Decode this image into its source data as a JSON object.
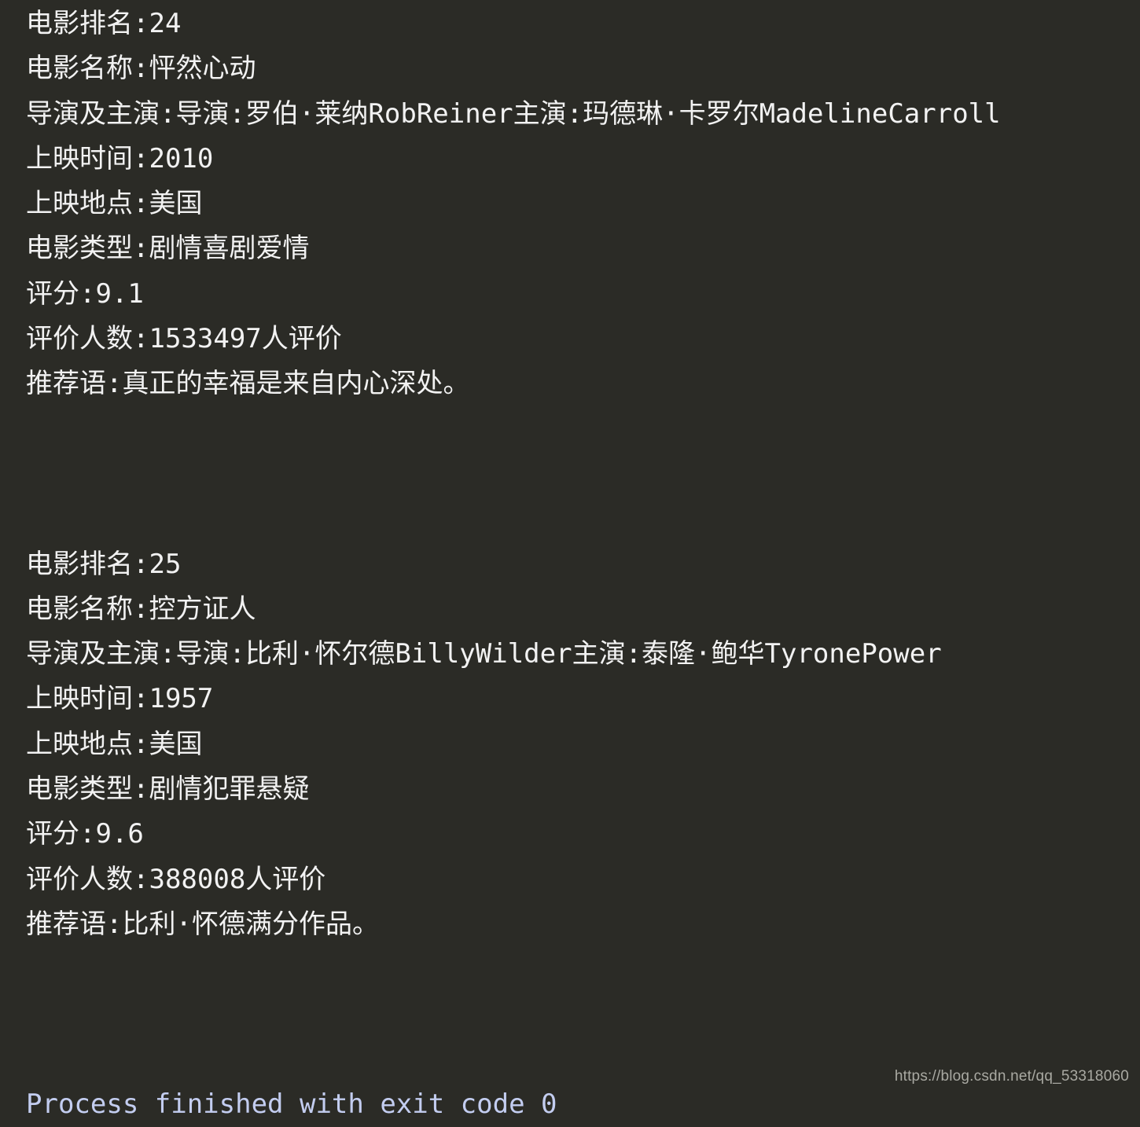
{
  "window": {
    "type": "ide-run-console",
    "background_color": "#2b2b26",
    "text_color": "#f2f2f2",
    "exit_code_color": "#c3cdf0",
    "watermark_color": "#a9a9a2"
  },
  "console": {
    "lines": [
      {
        "text": "电影排名:24",
        "style": "normal"
      },
      {
        "text": "电影名称:怦然心动",
        "style": "normal"
      },
      {
        "text": "导演及主演:导演:罗伯·莱纳RobReiner主演:玛德琳·卡罗尔MadelineCarroll",
        "style": "normal"
      },
      {
        "text": "上映时间:2010",
        "style": "normal"
      },
      {
        "text": "上映地点:美国",
        "style": "normal"
      },
      {
        "text": "电影类型:剧情喜剧爱情",
        "style": "normal"
      },
      {
        "text": "评分:9.1",
        "style": "normal"
      },
      {
        "text": "评价人数:1533497人评价",
        "style": "normal"
      },
      {
        "text": "推荐语:真正的幸福是来自内心深处。",
        "style": "normal"
      },
      {
        "text": "",
        "style": "blank"
      },
      {
        "text": "",
        "style": "blank"
      },
      {
        "text": "",
        "style": "blank"
      },
      {
        "text": "电影排名:25",
        "style": "normal"
      },
      {
        "text": "电影名称:控方证人",
        "style": "normal"
      },
      {
        "text": "导演及主演:导演:比利·怀尔德BillyWilder主演:泰隆·鲍华TyronePower",
        "style": "normal"
      },
      {
        "text": "上映时间:1957",
        "style": "normal"
      },
      {
        "text": "上映地点:美国",
        "style": "normal"
      },
      {
        "text": "电影类型:剧情犯罪悬疑",
        "style": "normal"
      },
      {
        "text": "评分:9.6",
        "style": "normal"
      },
      {
        "text": "评价人数:388008人评价",
        "style": "normal"
      },
      {
        "text": "推荐语:比利·怀德满分作品。",
        "style": "normal"
      },
      {
        "text": "",
        "style": "blank"
      },
      {
        "text": "",
        "style": "blank"
      },
      {
        "text": "",
        "style": "blank"
      },
      {
        "text": "Process finished with exit code 0",
        "style": "exit-code"
      }
    ]
  },
  "movies": [
    {
      "rank_label": "电影排名",
      "rank": "24",
      "title_label": "电影名称",
      "title": "怦然心动",
      "cast_label": "导演及主演",
      "cast": "导演:罗伯·莱纳RobReiner主演:玛德琳·卡罗尔MadelineCarroll",
      "year_label": "上映时间",
      "year": "2010",
      "place_label": "上映地点",
      "place": "美国",
      "genre_label": "电影类型",
      "genre": "剧情喜剧爱情",
      "rating_label": "评分",
      "rating": "9.1",
      "votes_label": "评价人数",
      "votes": "1533497人评价",
      "quote_label": "推荐语",
      "quote": "真正的幸福是来自内心深处。"
    },
    {
      "rank_label": "电影排名",
      "rank": "25",
      "title_label": "电影名称",
      "title": "控方证人",
      "cast_label": "导演及主演",
      "cast": "导演:比利·怀尔德BillyWilder主演:泰隆·鲍华TyronePower",
      "year_label": "上映时间",
      "year": "1957",
      "place_label": "上映地点",
      "place": "美国",
      "genre_label": "电影类型",
      "genre": "剧情犯罪悬疑",
      "rating_label": "评分",
      "rating": "9.6",
      "votes_label": "评价人数",
      "votes": "388008人评价",
      "quote_label": "推荐语",
      "quote": "比利·怀德满分作品。"
    }
  ],
  "status": {
    "exit_message": "Process finished with exit code 0"
  },
  "watermark": {
    "text": "https://blog.csdn.net/qq_53318060"
  }
}
